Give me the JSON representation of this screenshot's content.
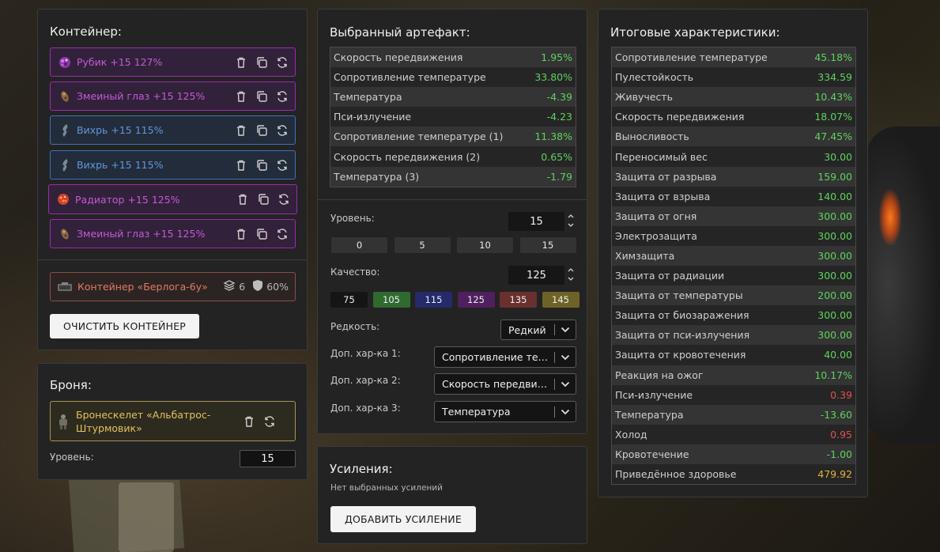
{
  "container_panel": {
    "title": "Контейнер:",
    "artefacts": [
      {
        "name": "Рубик +15 127%",
        "rarity": "legend",
        "icon": "rubik-icon"
      },
      {
        "name": "Змеиный глаз +15 125%",
        "rarity": "legend",
        "icon": "snake-eye-icon"
      },
      {
        "name": "Вихрь +15 115%",
        "rarity": "epic",
        "icon": "whirl-icon"
      },
      {
        "name": "Вихрь +15 115%",
        "rarity": "epic",
        "icon": "whirl-icon"
      },
      {
        "name": "Радиатор +15 125%",
        "rarity": "legend",
        "icon": "radiator-icon"
      },
      {
        "name": "Змеиный глаз +15 125%",
        "rarity": "legend",
        "icon": "snake-eye-icon"
      }
    ],
    "container": {
      "name": "Контейнер «Берлога-6у»",
      "slots": "6",
      "protection": "60%"
    },
    "clear_button": "ОЧИСТИТЬ КОНТЕЙНЕР"
  },
  "armor_panel": {
    "title": "Броня:",
    "armor_name": "Бронескелет «Альбатрос-Штурмовик»",
    "level_label": "Уровень:",
    "level_value": "15"
  },
  "artefact_panel": {
    "title": "Выбранный артефакт:",
    "stats": [
      {
        "k": "Скорость передвижения",
        "v": "1.95%",
        "c": "pos"
      },
      {
        "k": "Сопротивление температуре",
        "v": "33.80%",
        "c": "pos"
      },
      {
        "k": "Температура",
        "v": "-4.39",
        "c": "pos"
      },
      {
        "k": "Пси-излучение",
        "v": "-4.23",
        "c": "pos"
      },
      {
        "k": "Сопротивление температуре (1)",
        "v": "11.38%",
        "c": "pos"
      },
      {
        "k": "Скорость передвижения (2)",
        "v": "0.65%",
        "c": "pos"
      },
      {
        "k": "Температура (3)",
        "v": "-1.79",
        "c": "pos"
      }
    ],
    "level_label": "Уровень:",
    "level_value": "15",
    "level_presets": [
      "0",
      "5",
      "10",
      "15"
    ],
    "quality_label": "Качество:",
    "quality_value": "125",
    "quality_presets": [
      {
        "label": "75",
        "color": "#151515"
      },
      {
        "label": "105",
        "color": "#2f6a31"
      },
      {
        "label": "115",
        "color": "#252a6a"
      },
      {
        "label": "125",
        "color": "#4f1f5e"
      },
      {
        "label": "135",
        "color": "#6a302e"
      },
      {
        "label": "145",
        "color": "#6e6326"
      }
    ],
    "rarity_label": "Редкость:",
    "rarity_value": "Редкий",
    "extra1_label": "Доп. хар-ка 1:",
    "extra1_value": "Сопротивление температуре",
    "extra2_label": "Доп. хар-ка 2:",
    "extra2_value": "Скорость передвижения",
    "extra3_label": "Доп. хар-ка 3:",
    "extra3_value": "Температура"
  },
  "boost_panel": {
    "title": "Усиления:",
    "empty_text": "Нет выбранных усилений",
    "add_button": "ДОБАВИТЬ УСИЛЕНИЕ"
  },
  "total_panel": {
    "title": "Итоговые характеристики:",
    "stats": [
      {
        "k": "Сопротивление температуре",
        "v": "45.18%",
        "c": "pos"
      },
      {
        "k": "Пулестойкость",
        "v": "334.59",
        "c": "pos"
      },
      {
        "k": "Живучесть",
        "v": "10.43%",
        "c": "pos"
      },
      {
        "k": "Скорость передвижения",
        "v": "18.07%",
        "c": "pos"
      },
      {
        "k": "Выносливость",
        "v": "47.45%",
        "c": "pos"
      },
      {
        "k": "Переносимый вес",
        "v": "30.00",
        "c": "pos"
      },
      {
        "k": "Защита от разрыва",
        "v": "159.00",
        "c": "pos"
      },
      {
        "k": "Защита от взрыва",
        "v": "140.00",
        "c": "pos"
      },
      {
        "k": "Защита от огня",
        "v": "300.00",
        "c": "pos"
      },
      {
        "k": "Электрозащита",
        "v": "300.00",
        "c": "pos"
      },
      {
        "k": "Химзащита",
        "v": "300.00",
        "c": "pos"
      },
      {
        "k": "Защита от радиации",
        "v": "300.00",
        "c": "pos"
      },
      {
        "k": "Защита от температуры",
        "v": "200.00",
        "c": "pos"
      },
      {
        "k": "Защита от биозаражения",
        "v": "300.00",
        "c": "pos"
      },
      {
        "k": "Защита от пси-излучения",
        "v": "300.00",
        "c": "pos"
      },
      {
        "k": "Защита от кровотечения",
        "v": "40.00",
        "c": "pos"
      },
      {
        "k": "Реакция на ожог",
        "v": "10.17%",
        "c": "pos"
      },
      {
        "k": "Пси-излучение",
        "v": "0.39",
        "c": "neg"
      },
      {
        "k": "Температура",
        "v": "-13.60",
        "c": "pos"
      },
      {
        "k": "Холод",
        "v": "0.95",
        "c": "neg"
      },
      {
        "k": "Кровотечение",
        "v": "-1.00",
        "c": "pos"
      },
      {
        "k": "Приведённое здоровье",
        "v": "479.92",
        "c": "gold"
      }
    ]
  }
}
